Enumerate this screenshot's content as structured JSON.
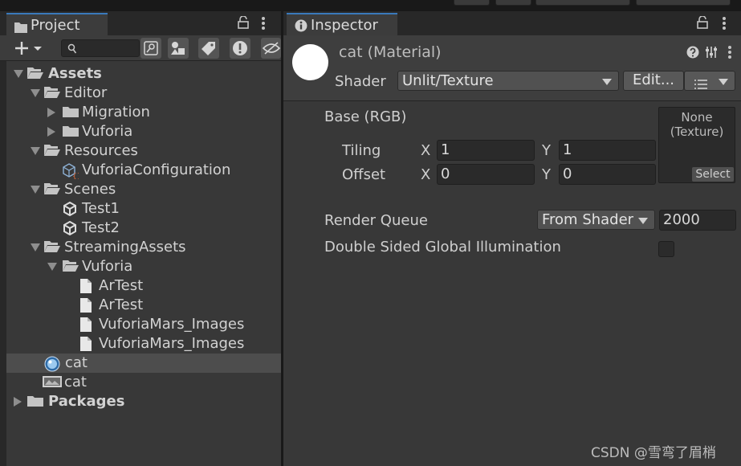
{
  "project": {
    "tab_label": "Project",
    "tree": [
      {
        "label": "Assets",
        "bold": true
      },
      {
        "label": "Editor"
      },
      {
        "label": "Migration"
      },
      {
        "label": "Vuforia"
      },
      {
        "label": "Resources"
      },
      {
        "label": "VuforiaConfiguration"
      },
      {
        "label": "Scenes"
      },
      {
        "label": "Test1"
      },
      {
        "label": "Test2"
      },
      {
        "label": "StreamingAssets"
      },
      {
        "label": "Vuforia"
      },
      {
        "label": "ArTest"
      },
      {
        "label": "ArTest"
      },
      {
        "label": "VuforiaMars_Images"
      },
      {
        "label": "VuforiaMars_Images"
      },
      {
        "label": "cat"
      },
      {
        "label": "cat"
      },
      {
        "label": "Packages",
        "bold": true
      }
    ]
  },
  "inspector": {
    "tab_label": "Inspector",
    "title": "cat (Material)",
    "shader_label": "Shader",
    "shader_value": "Unlit/Texture",
    "edit_label": "Edit...",
    "base_label": "Base (RGB)",
    "tiling_label": "Tiling",
    "offset_label": "Offset",
    "x_label": "X",
    "y_label": "Y",
    "tiling_x": "1",
    "tiling_y": "1",
    "offset_x": "0",
    "offset_y": "0",
    "texture_none": "None\n(Texture)",
    "texture_select": "Select",
    "render_queue_label": "Render Queue",
    "render_queue_mode": "From Shader",
    "render_queue_value": "2000",
    "double_sided_gi_label": "Double Sided Global Illumination"
  },
  "watermark": "CSDN @雪弯了眉梢",
  "colors": {
    "panel_bg": "#383838",
    "tab_accent": "#3a79bb",
    "selected_row": "#4d4d4d",
    "input_bg": "#2a2a2a"
  }
}
